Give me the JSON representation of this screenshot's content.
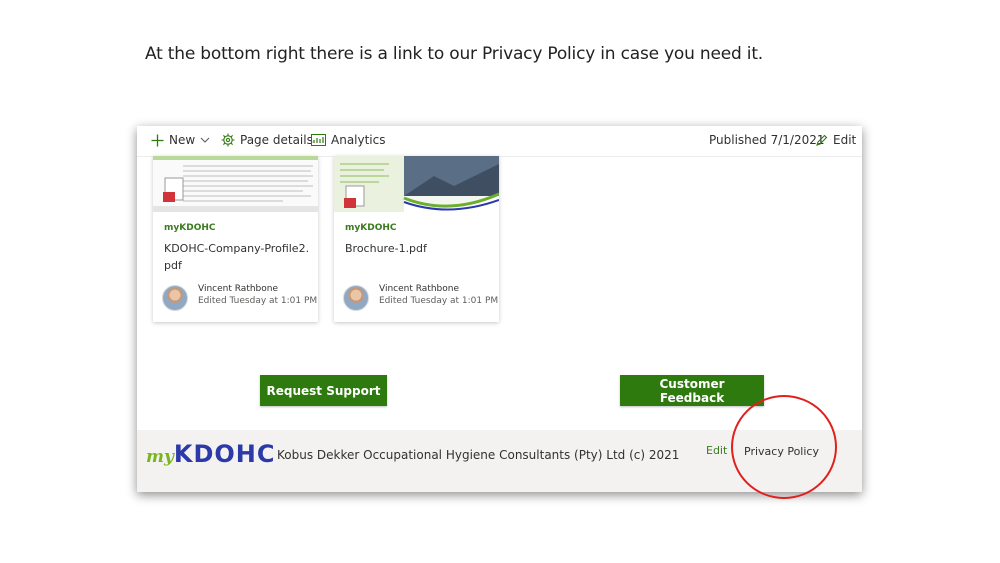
{
  "caption": "At the bottom right there is a link to our Privacy Policy in case you need it.",
  "command_bar": {
    "new_label": "New",
    "page_details_label": "Page details",
    "analytics_label": "Analytics",
    "published_label": "Published 7/1/2021",
    "edit_label": "Edit"
  },
  "documents": [
    {
      "site": "myKDOHC",
      "title": "KDOHC-Company-Profile2.pdf",
      "author": "Vincent Rathbone",
      "edited": "Edited Tuesday at 1:01 PM"
    },
    {
      "site": "myKDOHC",
      "title": "Brochure-1.pdf",
      "author": "Vincent Rathbone",
      "edited": "Edited Tuesday at 1:01 PM"
    }
  ],
  "buttons": {
    "request_support": "Request Support",
    "customer_feedback": "Customer Feedback"
  },
  "footer": {
    "logo_my": "my",
    "logo_name": "KDOHC",
    "text": "Kobus Dekker Occupational Hygiene Consultants (Pty) Ltd (c) 2021",
    "edit_label": "Edit",
    "privacy_label": "Privacy Policy"
  },
  "colors": {
    "accent_green": "#2f7a0f",
    "site_green": "#3b7b1e",
    "logo_blue": "#2b3aa8",
    "logo_lime": "#7ab51d",
    "highlight_red": "#e0201c"
  },
  "icons": [
    "plus-icon",
    "chevron-down-icon",
    "gear-icon",
    "analytics-icon",
    "pencil-icon"
  ]
}
